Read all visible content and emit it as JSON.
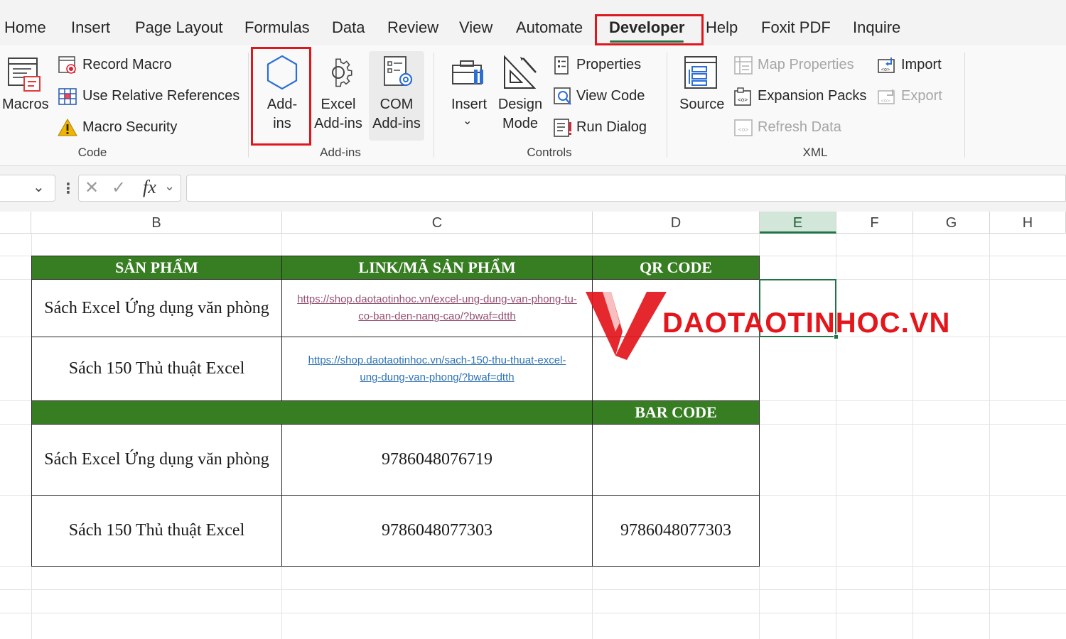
{
  "tabs": [
    "Home",
    "Insert",
    "Page Layout",
    "Formulas",
    "Data",
    "Review",
    "View",
    "Automate",
    "Developer",
    "Help",
    "Foxit PDF",
    "Inquire"
  ],
  "active_tab": "Developer",
  "ribbon": {
    "code": {
      "macros": "Macros",
      "record_macro": "Record Macro",
      "use_relative_references": "Use Relative References",
      "macro_security": "Macro Security",
      "group_label": "Code"
    },
    "addins": {
      "addins_line1": "Add-",
      "addins_line2": "ins",
      "excel_line1": "Excel",
      "excel_line2": "Add-ins",
      "com_line1": "COM",
      "com_line2": "Add-ins",
      "group_label": "Add-ins"
    },
    "controls": {
      "insert": "Insert",
      "design_line1": "Design",
      "design_line2": "Mode",
      "properties": "Properties",
      "view_code": "View Code",
      "run_dialog": "Run Dialog",
      "group_label": "Controls"
    },
    "xml": {
      "source": "Source",
      "map_properties": "Map Properties",
      "expansion_packs": "Expansion Packs",
      "refresh_data": "Refresh Data",
      "import": "Import",
      "export": "Export",
      "group_label": "XML"
    }
  },
  "formula_bar": {
    "fx_label": "fx",
    "value": ""
  },
  "columns": [
    "B",
    "C",
    "D",
    "E",
    "F",
    "G",
    "H"
  ],
  "selected_column": "E",
  "table": {
    "header": {
      "product": "SẢN PHẨM",
      "link": "LINK/MÃ SẢN PHẨM",
      "qr": "QR CODE"
    },
    "rows_links": [
      {
        "product": "Sách Excel Ứng dụng văn phòng",
        "link_line1": "https://shop.daotaotinhoc.vn/excel-ung-dung-van-phong-tu-",
        "link_line2": "co-ban-den-nang-cao/?bwaf=dtth"
      },
      {
        "product": "Sách 150 Thủ thuật Excel",
        "link_line1": "https://shop.daotaotinhoc.vn/sach-150-thu-thuat-excel-",
        "link_line2": "ung-dung-van-phong/?bwaf=dtth"
      }
    ],
    "barcode_header": "BAR CODE",
    "rows_codes": [
      {
        "product": "Sách Excel Ứng dụng văn phòng",
        "code": "9786048076719",
        "barcode": ""
      },
      {
        "product": "Sách 150 Thủ thuật Excel",
        "code": "9786048077303",
        "barcode": "9786048077303"
      }
    ]
  },
  "watermark": {
    "text": "DAOTAOTINHOC.VN"
  },
  "colors": {
    "header_green": "#377d22",
    "highlight_red": "#e0161d",
    "excel_green": "#217346"
  }
}
